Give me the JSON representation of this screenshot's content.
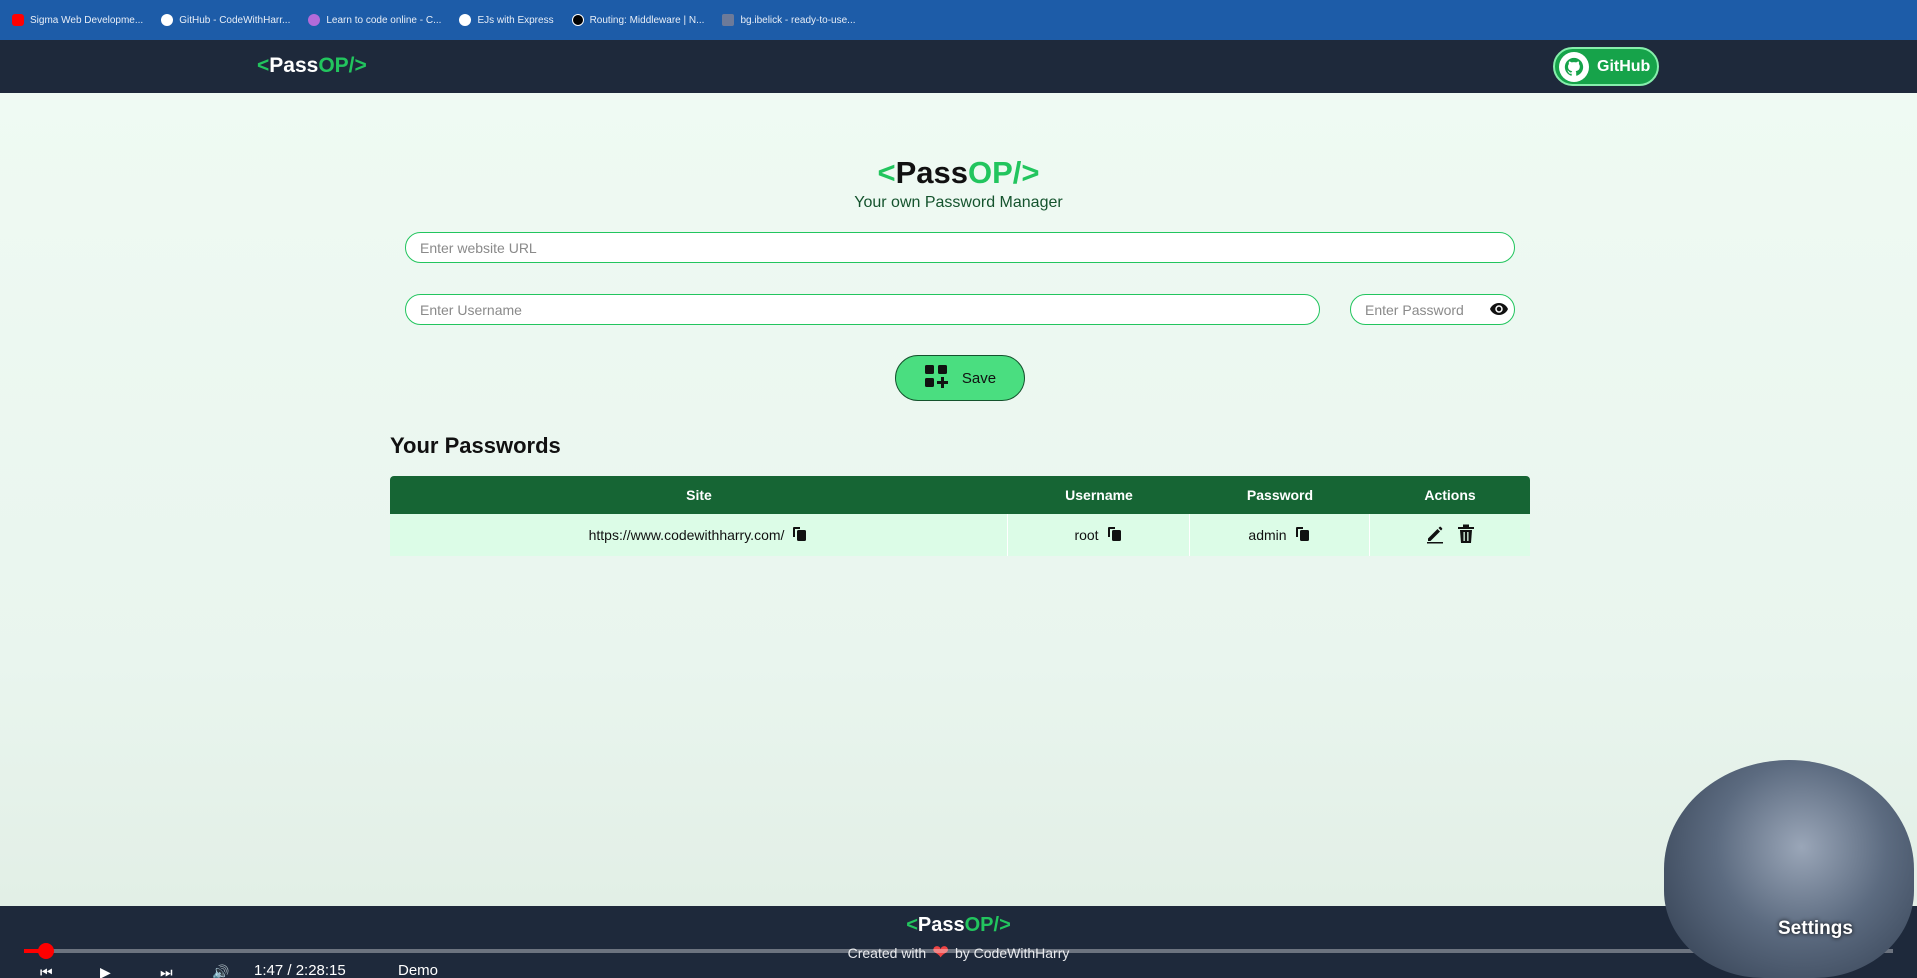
{
  "bookmarks": [
    {
      "label": "Sigma Web Developme...",
      "color": "#ff0000"
    },
    {
      "label": "GitHub - CodeWithHarr...",
      "color": "#ffffff"
    },
    {
      "label": "Learn to code online - C...",
      "color": "#b36bd9"
    },
    {
      "label": "EJs with Express",
      "color": "#ffffff"
    },
    {
      "label": "Routing: Middleware | N...",
      "color": "#000000"
    },
    {
      "label": "bg.ibelick - ready-to-use...",
      "color": "#6c7a99"
    }
  ],
  "navbar": {
    "logo_open": "<",
    "logo_main": "Pass",
    "logo_op": "OP/>",
    "github_label": "GitHub"
  },
  "hero": {
    "logo_open": "<",
    "logo_main": "Pass",
    "logo_op": "OP/>",
    "subtitle": "Your own Password Manager"
  },
  "form": {
    "site_placeholder": "Enter website URL",
    "username_placeholder": "Enter Username",
    "password_placeholder": "Enter Password",
    "save_label": "Save"
  },
  "passwords": {
    "title": "Your Passwords",
    "headers": [
      "Site",
      "Username",
      "Password",
      "Actions"
    ],
    "rows": [
      {
        "site": "https://www.codewithharry.com/",
        "username": "root",
        "password": "admin"
      }
    ]
  },
  "footer": {
    "logo_open": "<",
    "logo_main": "Pass",
    "logo_op": "OP/>",
    "created_with": "Created with",
    "by": "by CodeWithHarry"
  },
  "player": {
    "time": "1:47 / 2:28:15",
    "chapter": "Demo",
    "settings_label": "Settings",
    "progress_fraction": 0.012
  },
  "colors": {
    "accent": "#22c55e",
    "navbar": "#1e293b",
    "table_header": "#166534",
    "table_row": "#dcfce7"
  }
}
